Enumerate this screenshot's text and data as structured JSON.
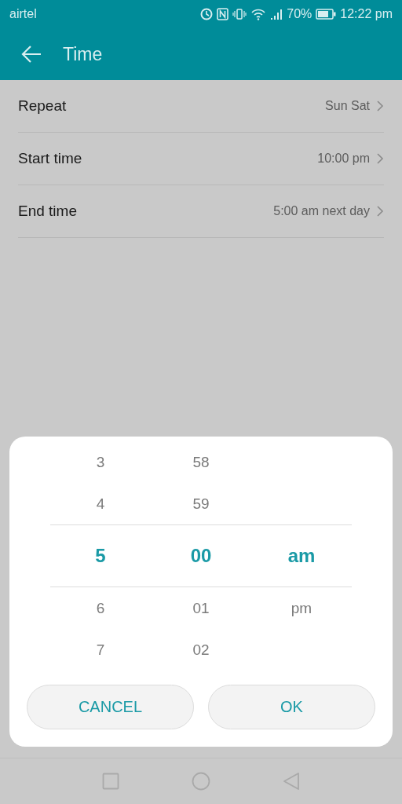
{
  "status_bar": {
    "carrier": "airtel",
    "battery": "70%",
    "time": "12:22 pm"
  },
  "app_bar": {
    "title": "Time"
  },
  "settings": [
    {
      "label": "Repeat",
      "value": "Sun Sat"
    },
    {
      "label": "Start time",
      "value": "10:00 pm"
    },
    {
      "label": "End time",
      "value": "5:00 am next day"
    }
  ],
  "picker": {
    "columns": [
      {
        "items": [
          {
            "text": "3",
            "selected": false
          },
          {
            "text": "4",
            "selected": false
          },
          {
            "text": "5",
            "selected": true
          },
          {
            "text": "6",
            "selected": false
          },
          {
            "text": "7",
            "selected": false
          }
        ]
      },
      {
        "items": [
          {
            "text": "58",
            "selected": false
          },
          {
            "text": "59",
            "selected": false
          },
          {
            "text": "00",
            "selected": true
          },
          {
            "text": "01",
            "selected": false
          },
          {
            "text": "02",
            "selected": false
          }
        ]
      },
      {
        "items": [
          {
            "text": "am",
            "selected": true
          },
          {
            "text": "pm",
            "selected": false
          }
        ]
      }
    ],
    "buttons": [
      "CANCEL",
      "OK"
    ]
  }
}
